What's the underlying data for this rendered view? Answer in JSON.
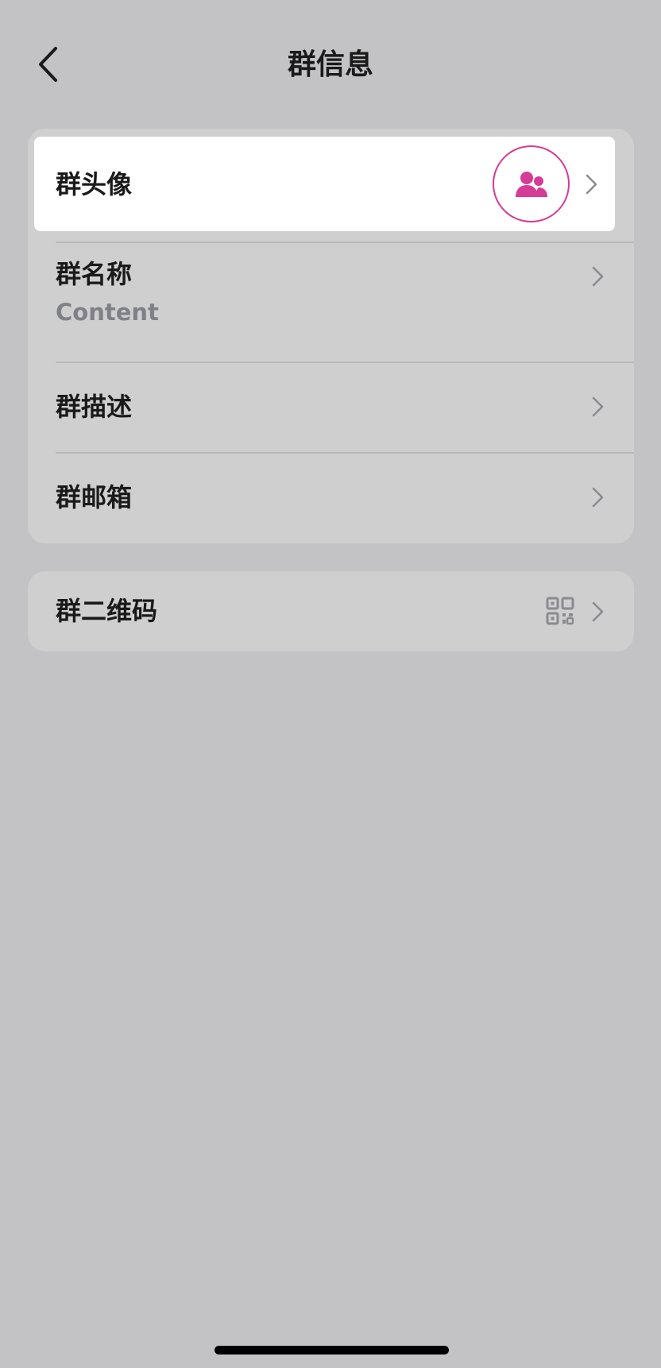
{
  "header": {
    "title": "群信息",
    "back_icon": "chevron-left-icon"
  },
  "group_info": {
    "avatar_row": {
      "label": "群头像",
      "avatar_icon": "group-users-icon",
      "accent_color": "#d63b95"
    },
    "name_row": {
      "label": "群名称",
      "value": "Content"
    },
    "description_row": {
      "label": "群描述"
    },
    "email_row": {
      "label": "群邮箱"
    }
  },
  "qr_section": {
    "qr_row": {
      "label": "群二维码",
      "icon": "qr-code-icon"
    }
  },
  "colors": {
    "background": "#c3c3c5",
    "card": "#cfcfd0",
    "highlight_row": "#ffffff",
    "accent": "#d63b95",
    "secondary_text": "#808088"
  }
}
